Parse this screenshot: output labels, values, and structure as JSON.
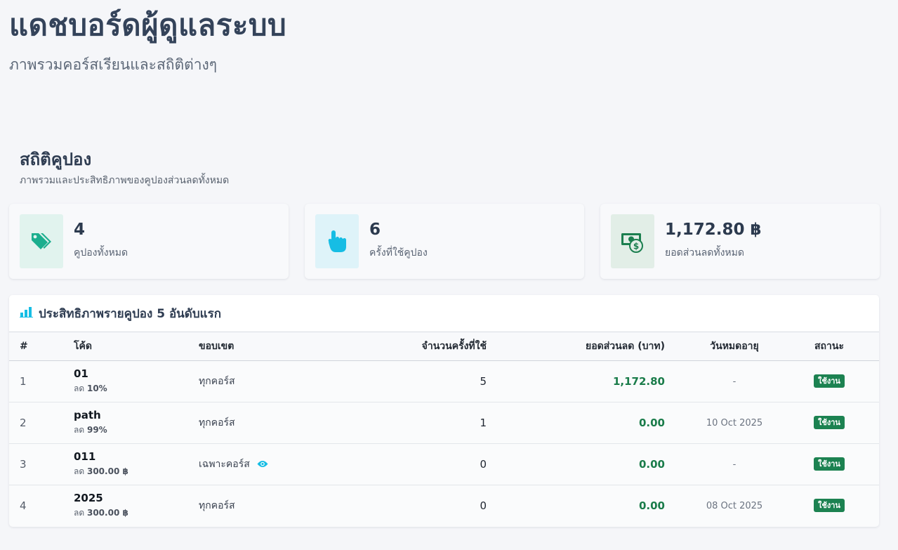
{
  "page": {
    "title": "แดชบอร์ดผู้ดูแลระบบ",
    "subtitle": "ภาพรวมคอร์สเรียนและสถิติต่างๆ"
  },
  "coupon_section": {
    "title": "สถิติคูปอง",
    "subtitle": "ภาพรวมและประสิทธิภาพของคูปองส่วนลดทั้งหมด"
  },
  "stats": [
    {
      "value": "4",
      "label": "คูปองทั้งหมด",
      "icon": "tags-icon",
      "icon_color": "#1bae8e",
      "icon_bg": "#e1f3ee"
    },
    {
      "value": "6",
      "label": "ครั้งที่ใช้คูปอง",
      "icon": "hand-pointer-icon",
      "icon_color": "#16bde4",
      "icon_bg": "#def3f9"
    },
    {
      "value": "1,172.80 ฿",
      "label": "ยอดส่วนลดทั้งหมด",
      "icon": "money-bill-icon",
      "icon_color": "#1b7f4f",
      "icon_bg": "#e2eee7"
    }
  ],
  "table": {
    "title": "ประสิทธิภาพรายคูปอง 5 อันดับแรก",
    "title_icon": "bar-chart-icon",
    "title_icon_color": "#16bde4",
    "headers": {
      "num": "#",
      "code": "โค้ด",
      "scope": "ขอบเขต",
      "uses": "จำนวนครั้งที่ใช้",
      "discount": "ยอดส่วนลด (บาท)",
      "expiry": "วันหมดอายุ",
      "status": "สถานะ"
    },
    "rows": [
      {
        "num": "1",
        "code": "01",
        "discount_prefix": "ลด",
        "discount_amount": "10%",
        "scope": "ทุกคอร์ส",
        "scope_icon": "",
        "uses": "5",
        "total_discount": "1,172.80",
        "expiry": "-",
        "status": "ใช้งาน"
      },
      {
        "num": "2",
        "code": "path",
        "discount_prefix": "ลด",
        "discount_amount": "99%",
        "scope": "ทุกคอร์ส",
        "scope_icon": "",
        "uses": "1",
        "total_discount": "0.00",
        "expiry": "10 Oct 2025",
        "status": "ใช้งาน"
      },
      {
        "num": "3",
        "code": "011",
        "discount_prefix": "ลด",
        "discount_amount": "300.00 ฿",
        "scope": "เฉพาะคอร์ส",
        "scope_icon": "eye-icon",
        "uses": "0",
        "total_discount": "0.00",
        "expiry": "-",
        "status": "ใช้งาน"
      },
      {
        "num": "4",
        "code": "2025",
        "discount_prefix": "ลด",
        "discount_amount": "300.00 ฿",
        "scope": "ทุกคอร์ส",
        "scope_icon": "",
        "uses": "0",
        "total_discount": "0.00",
        "expiry": "08 Oct 2025",
        "status": "ใช้งาน"
      }
    ]
  },
  "colors": {
    "accent_green": "#1c8251",
    "accent_cyan": "#16bde4"
  }
}
